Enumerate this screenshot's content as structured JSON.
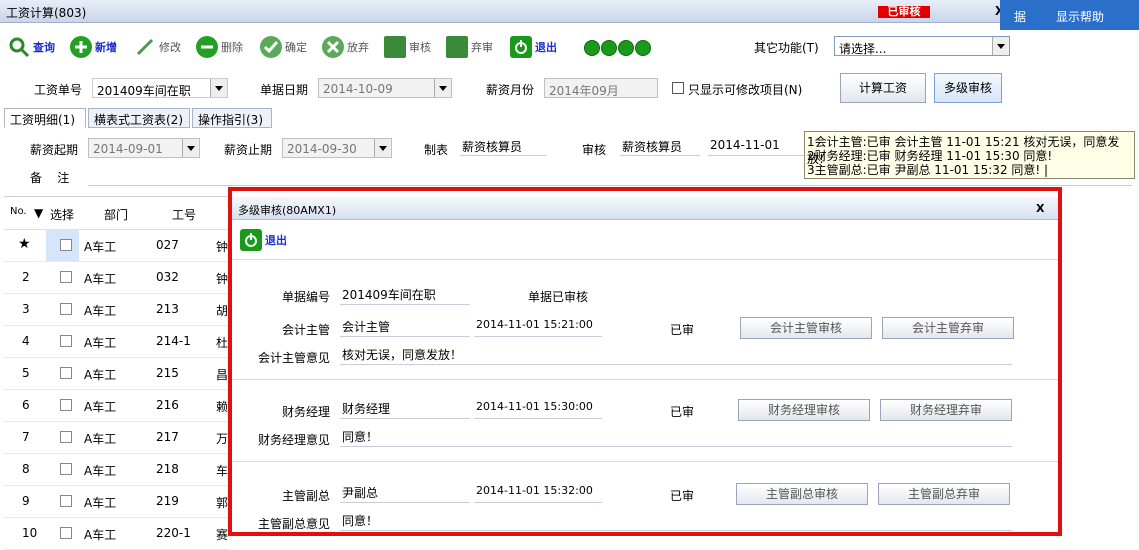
{
  "window": {
    "title": "工资计算(803)",
    "status_badge": "已审核",
    "close": "X"
  },
  "menubar": {
    "item1": "据",
    "item2": "显示帮助"
  },
  "toolbar": {
    "query": "查询",
    "add": "新增",
    "edit": "修改",
    "delete": "删除",
    "confirm": "确定",
    "abandon": "放弃",
    "audit": "审核",
    "unaudit": "弃审",
    "exit": "退出",
    "other_label": "其它功能(T)",
    "other_value": "请选择..."
  },
  "form": {
    "bill_no_label": "工资单号",
    "bill_no": "201409车间在职",
    "bill_date_label": "单据日期",
    "bill_date": "2014-10-09",
    "month_label": "薪资月份",
    "month": "2014年09月",
    "editable_only_label": "只显示可修改项目(N)",
    "calc_button": "计算工资",
    "multi_audit_button": "多级审核",
    "start_label": "薪资起期",
    "start": "2014-09-01",
    "end_label": "薪资止期",
    "end": "2014-09-30",
    "maker_label": "制表",
    "maker": "薪资核算员",
    "auditor_label": "审核",
    "auditor": "薪资核算员",
    "audit_date": "2014-11-01",
    "remark_label": "备    注"
  },
  "tabs": [
    "工资明细(1)",
    "横表式工资表(2)",
    "操作指引(3)"
  ],
  "tooltip": {
    "line1": "1会计主管:已审 会计主管 11-01 15:21 核对无误，同意发放!",
    "line2": "2财务经理:已审 财务经理 11-01 15:30 同意!",
    "line3": "3主管副总:已审 尹副总 11-01 15:32 同意! |"
  },
  "grid": {
    "headers": {
      "no": "No.",
      "select": "选择",
      "dept": "部门",
      "id": "工号"
    },
    "rows": [
      {
        "no": "★",
        "dept": "A车工",
        "id": "027",
        "name": "钟"
      },
      {
        "no": "2",
        "dept": "A车工",
        "id": "032",
        "name": "钟"
      },
      {
        "no": "3",
        "dept": "A车工",
        "id": "213",
        "name": "胡"
      },
      {
        "no": "4",
        "dept": "A车工",
        "id": "214-1",
        "name": "杜"
      },
      {
        "no": "5",
        "dept": "A车工",
        "id": "215",
        "name": "昌"
      },
      {
        "no": "6",
        "dept": "A车工",
        "id": "216",
        "name": "赖"
      },
      {
        "no": "7",
        "dept": "A车工",
        "id": "217",
        "name": "万"
      },
      {
        "no": "8",
        "dept": "A车工",
        "id": "218",
        "name": "车"
      },
      {
        "no": "9",
        "dept": "A车工",
        "id": "219",
        "name": "郭"
      },
      {
        "no": "10",
        "dept": "A车工",
        "id": "220-1",
        "name": "赛"
      }
    ]
  },
  "dialog": {
    "title": "多级审核(80AMX1)",
    "close": "X",
    "exit": "退出",
    "bill_no_label": "单据编号",
    "bill_no": "201409车间在职",
    "bill_status": "单据已审核",
    "levels": [
      {
        "role_label": "会计主管",
        "person": "会计主管",
        "time": "2014-11-01 15:21:00",
        "status": "已审",
        "audit_btn": "会计主管审核",
        "unaudit_btn": "会计主管弃审",
        "opinion_label": "会计主管意见",
        "opinion": "核对无误，同意发放！"
      },
      {
        "role_label": "财务经理",
        "person": "财务经理",
        "time": "2014-11-01 15:30:00",
        "status": "已审",
        "audit_btn": "财务经理审核",
        "unaudit_btn": "财务经理弃审",
        "opinion_label": "财务经理意见",
        "opinion": "同意！"
      },
      {
        "role_label": "主管副总",
        "person": "尹副总",
        "time": "2014-11-01 15:32:00",
        "status": "已审",
        "audit_btn": "主管副总审核",
        "unaudit_btn": "主管副总弃审",
        "opinion_label": "主管副总意见",
        "opinion": "同意！"
      }
    ]
  }
}
